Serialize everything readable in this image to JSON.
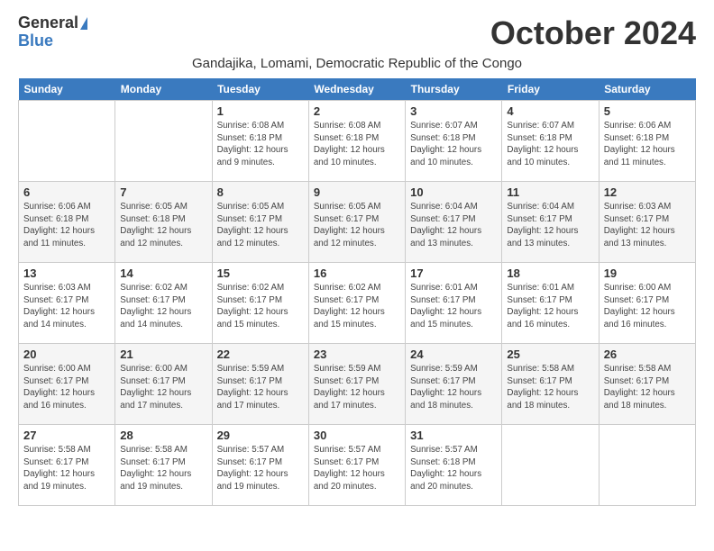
{
  "logo": {
    "general": "General",
    "blue": "Blue"
  },
  "title": "October 2024",
  "subtitle": "Gandajika, Lomami, Democratic Republic of the Congo",
  "days_of_week": [
    "Sunday",
    "Monday",
    "Tuesday",
    "Wednesday",
    "Thursday",
    "Friday",
    "Saturday"
  ],
  "weeks": [
    [
      {
        "num": "",
        "info": ""
      },
      {
        "num": "",
        "info": ""
      },
      {
        "num": "1",
        "info": "Sunrise: 6:08 AM\nSunset: 6:18 PM\nDaylight: 12 hours and 9 minutes."
      },
      {
        "num": "2",
        "info": "Sunrise: 6:08 AM\nSunset: 6:18 PM\nDaylight: 12 hours and 10 minutes."
      },
      {
        "num": "3",
        "info": "Sunrise: 6:07 AM\nSunset: 6:18 PM\nDaylight: 12 hours and 10 minutes."
      },
      {
        "num": "4",
        "info": "Sunrise: 6:07 AM\nSunset: 6:18 PM\nDaylight: 12 hours and 10 minutes."
      },
      {
        "num": "5",
        "info": "Sunrise: 6:06 AM\nSunset: 6:18 PM\nDaylight: 12 hours and 11 minutes."
      }
    ],
    [
      {
        "num": "6",
        "info": "Sunrise: 6:06 AM\nSunset: 6:18 PM\nDaylight: 12 hours and 11 minutes."
      },
      {
        "num": "7",
        "info": "Sunrise: 6:05 AM\nSunset: 6:18 PM\nDaylight: 12 hours and 12 minutes."
      },
      {
        "num": "8",
        "info": "Sunrise: 6:05 AM\nSunset: 6:17 PM\nDaylight: 12 hours and 12 minutes."
      },
      {
        "num": "9",
        "info": "Sunrise: 6:05 AM\nSunset: 6:17 PM\nDaylight: 12 hours and 12 minutes."
      },
      {
        "num": "10",
        "info": "Sunrise: 6:04 AM\nSunset: 6:17 PM\nDaylight: 12 hours and 13 minutes."
      },
      {
        "num": "11",
        "info": "Sunrise: 6:04 AM\nSunset: 6:17 PM\nDaylight: 12 hours and 13 minutes."
      },
      {
        "num": "12",
        "info": "Sunrise: 6:03 AM\nSunset: 6:17 PM\nDaylight: 12 hours and 13 minutes."
      }
    ],
    [
      {
        "num": "13",
        "info": "Sunrise: 6:03 AM\nSunset: 6:17 PM\nDaylight: 12 hours and 14 minutes."
      },
      {
        "num": "14",
        "info": "Sunrise: 6:02 AM\nSunset: 6:17 PM\nDaylight: 12 hours and 14 minutes."
      },
      {
        "num": "15",
        "info": "Sunrise: 6:02 AM\nSunset: 6:17 PM\nDaylight: 12 hours and 15 minutes."
      },
      {
        "num": "16",
        "info": "Sunrise: 6:02 AM\nSunset: 6:17 PM\nDaylight: 12 hours and 15 minutes."
      },
      {
        "num": "17",
        "info": "Sunrise: 6:01 AM\nSunset: 6:17 PM\nDaylight: 12 hours and 15 minutes."
      },
      {
        "num": "18",
        "info": "Sunrise: 6:01 AM\nSunset: 6:17 PM\nDaylight: 12 hours and 16 minutes."
      },
      {
        "num": "19",
        "info": "Sunrise: 6:00 AM\nSunset: 6:17 PM\nDaylight: 12 hours and 16 minutes."
      }
    ],
    [
      {
        "num": "20",
        "info": "Sunrise: 6:00 AM\nSunset: 6:17 PM\nDaylight: 12 hours and 16 minutes."
      },
      {
        "num": "21",
        "info": "Sunrise: 6:00 AM\nSunset: 6:17 PM\nDaylight: 12 hours and 17 minutes."
      },
      {
        "num": "22",
        "info": "Sunrise: 5:59 AM\nSunset: 6:17 PM\nDaylight: 12 hours and 17 minutes."
      },
      {
        "num": "23",
        "info": "Sunrise: 5:59 AM\nSunset: 6:17 PM\nDaylight: 12 hours and 17 minutes."
      },
      {
        "num": "24",
        "info": "Sunrise: 5:59 AM\nSunset: 6:17 PM\nDaylight: 12 hours and 18 minutes."
      },
      {
        "num": "25",
        "info": "Sunrise: 5:58 AM\nSunset: 6:17 PM\nDaylight: 12 hours and 18 minutes."
      },
      {
        "num": "26",
        "info": "Sunrise: 5:58 AM\nSunset: 6:17 PM\nDaylight: 12 hours and 18 minutes."
      }
    ],
    [
      {
        "num": "27",
        "info": "Sunrise: 5:58 AM\nSunset: 6:17 PM\nDaylight: 12 hours and 19 minutes."
      },
      {
        "num": "28",
        "info": "Sunrise: 5:58 AM\nSunset: 6:17 PM\nDaylight: 12 hours and 19 minutes."
      },
      {
        "num": "29",
        "info": "Sunrise: 5:57 AM\nSunset: 6:17 PM\nDaylight: 12 hours and 19 minutes."
      },
      {
        "num": "30",
        "info": "Sunrise: 5:57 AM\nSunset: 6:17 PM\nDaylight: 12 hours and 20 minutes."
      },
      {
        "num": "31",
        "info": "Sunrise: 5:57 AM\nSunset: 6:18 PM\nDaylight: 12 hours and 20 minutes."
      },
      {
        "num": "",
        "info": ""
      },
      {
        "num": "",
        "info": ""
      }
    ]
  ]
}
